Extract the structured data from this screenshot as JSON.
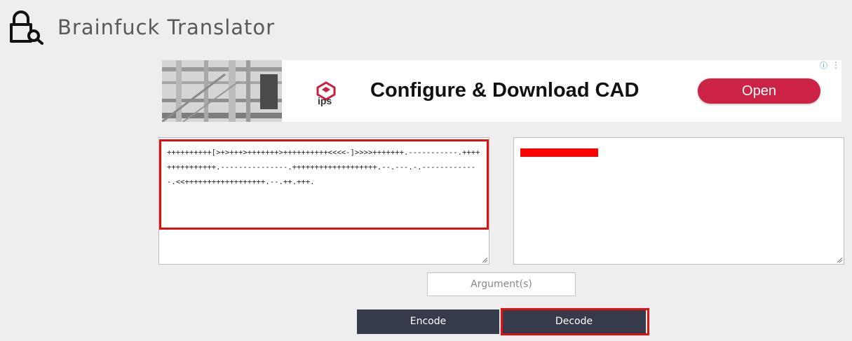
{
  "header": {
    "title": "Brainfuck Translator",
    "logo_icon": "lock-search-icon"
  },
  "ad": {
    "brand_text": "ips",
    "headline": "Configure & Download CAD",
    "cta_label": "Open",
    "cta_color": "#cc2244",
    "info_glyph": "ⓘ",
    "menu_glyph": "⋮"
  },
  "input": {
    "code": "++++++++++[>+>+++>+++++++>++++++++++<<<<-]>>>>+++++++.-----------.+++++++++++++++.---------------.+++++++++++++++++++.--.---.-.-------------.<<++++++++++++++++++.--.++.+++."
  },
  "output": {
    "redacted": true
  },
  "argument": {
    "placeholder": "Argument(s)"
  },
  "buttons": {
    "encode_label": "Encode",
    "decode_label": "Decode"
  },
  "colors": {
    "background": "#eeeeee",
    "button_bg": "#353b4b",
    "highlight": "#e01010",
    "title": "#555a5f"
  }
}
